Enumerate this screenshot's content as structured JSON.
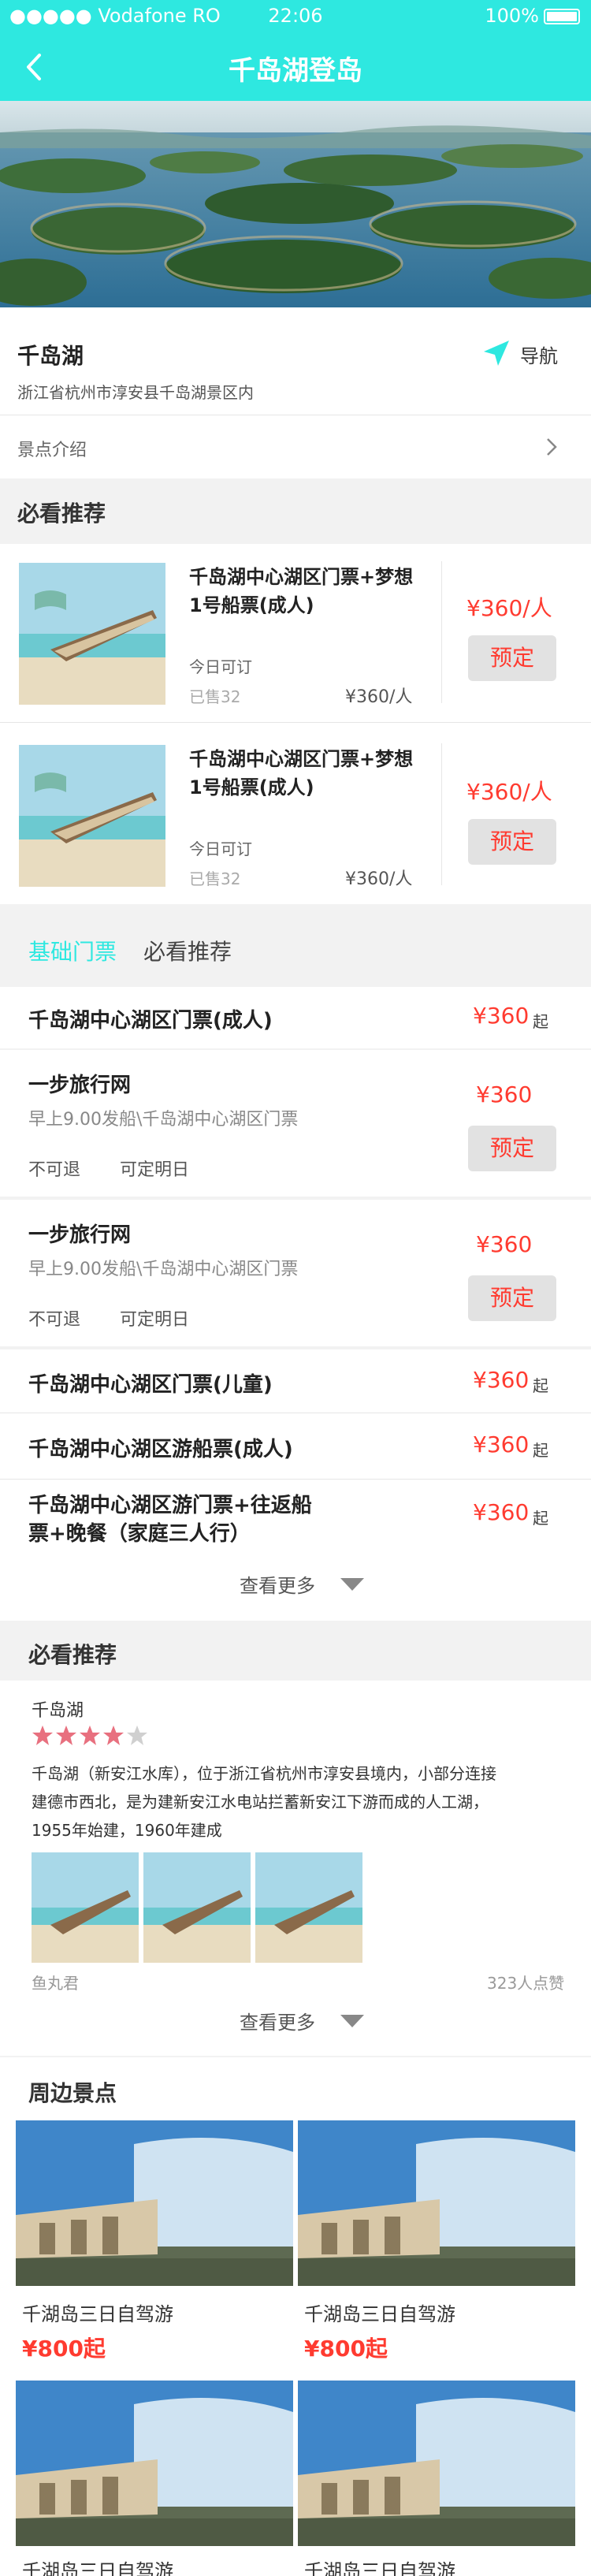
{
  "status_bar": {
    "carrier": "●●●●● Vodafone RO",
    "time": "22:06",
    "battery": "100%"
  },
  "header": {
    "title": "千岛湖登岛"
  },
  "place": {
    "name": "千岛湖",
    "address": "浙江省杭州市淳安县千岛湖景区内",
    "nav_label": "导航",
    "intro_label": "景点介绍"
  },
  "must_see": {
    "title": "必看推荐",
    "items": [
      {
        "name": "千岛湖中心湖区门票+梦想1号船票(成人)",
        "name_line1": "千岛湖中心湖区门票+梦想",
        "name_line2": "1号船票(成人)",
        "availability": "今日可订",
        "sold": "已售32",
        "price_small": "¥360/人",
        "price": "¥360/人",
        "button": "预定"
      },
      {
        "name": "千岛湖中心湖区门票+梦想1号船票(成人)",
        "name_line1": "千岛湖中心湖区门票+梦想",
        "name_line2": "1号船票(成人)",
        "availability": "今日可订",
        "sold": "已售32",
        "price_small": "¥360/人",
        "price": "¥360/人",
        "button": "预定"
      }
    ]
  },
  "tickets": {
    "tabs": [
      "基础门票",
      "必看推荐"
    ],
    "groups": [
      {
        "name": "千岛湖中心湖区门票(成人)",
        "price": "¥360",
        "suffix": "起"
      }
    ],
    "offers": [
      {
        "vendor": "一步旅行网",
        "desc": "早上9.00发船\\千岛湖中心湖区门票",
        "tag1": "不可退",
        "tag2": "可定明日",
        "price": "¥360",
        "button": "预定"
      },
      {
        "vendor": "一步旅行网",
        "desc": "早上9.00发船\\千岛湖中心湖区门票",
        "tag1": "不可退",
        "tag2": "可定明日",
        "price": "¥360",
        "button": "预定"
      }
    ],
    "more_groups": [
      {
        "name": "千岛湖中心湖区门票(儿童)",
        "price": "¥360",
        "suffix": "起"
      },
      {
        "name": "千岛湖中心湖区游船票(成人)",
        "price": "¥360",
        "suffix": "起"
      },
      {
        "name_line1": "千岛湖中心湖区游门票+往返船",
        "name_line2": "票+晚餐（家庭三人行）",
        "price": "¥360",
        "suffix": "起"
      }
    ],
    "see_more": "查看更多"
  },
  "review": {
    "title": "必看推荐",
    "place": "千岛湖",
    "rating": 4,
    "rating_max": 5,
    "text_line1": "千岛湖（新安江水库），位于浙江省杭州市淳安县境内，小部分连接",
    "text_line2": "建德市西北，是为建新安江水电站拦蓄新安江下游而成的人工湖，",
    "text_line3": "1955年始建，1960年建成",
    "author": "鱼丸君",
    "likes": "323人点赞",
    "see_more": "查看更多"
  },
  "nearby": {
    "title": "周边景点",
    "items": [
      {
        "name": "千湖岛三日自驾游",
        "price": "¥800起"
      },
      {
        "name": "千湖岛三日自驾游",
        "price": "¥800起"
      },
      {
        "name": "千湖岛三日自驾游",
        "price": ""
      },
      {
        "name": "千湖岛三日自驾游",
        "price": ""
      }
    ]
  },
  "colors": {
    "accent": "#2ee8e0",
    "price_red": "#ff3b30",
    "star": "#e8707f"
  }
}
